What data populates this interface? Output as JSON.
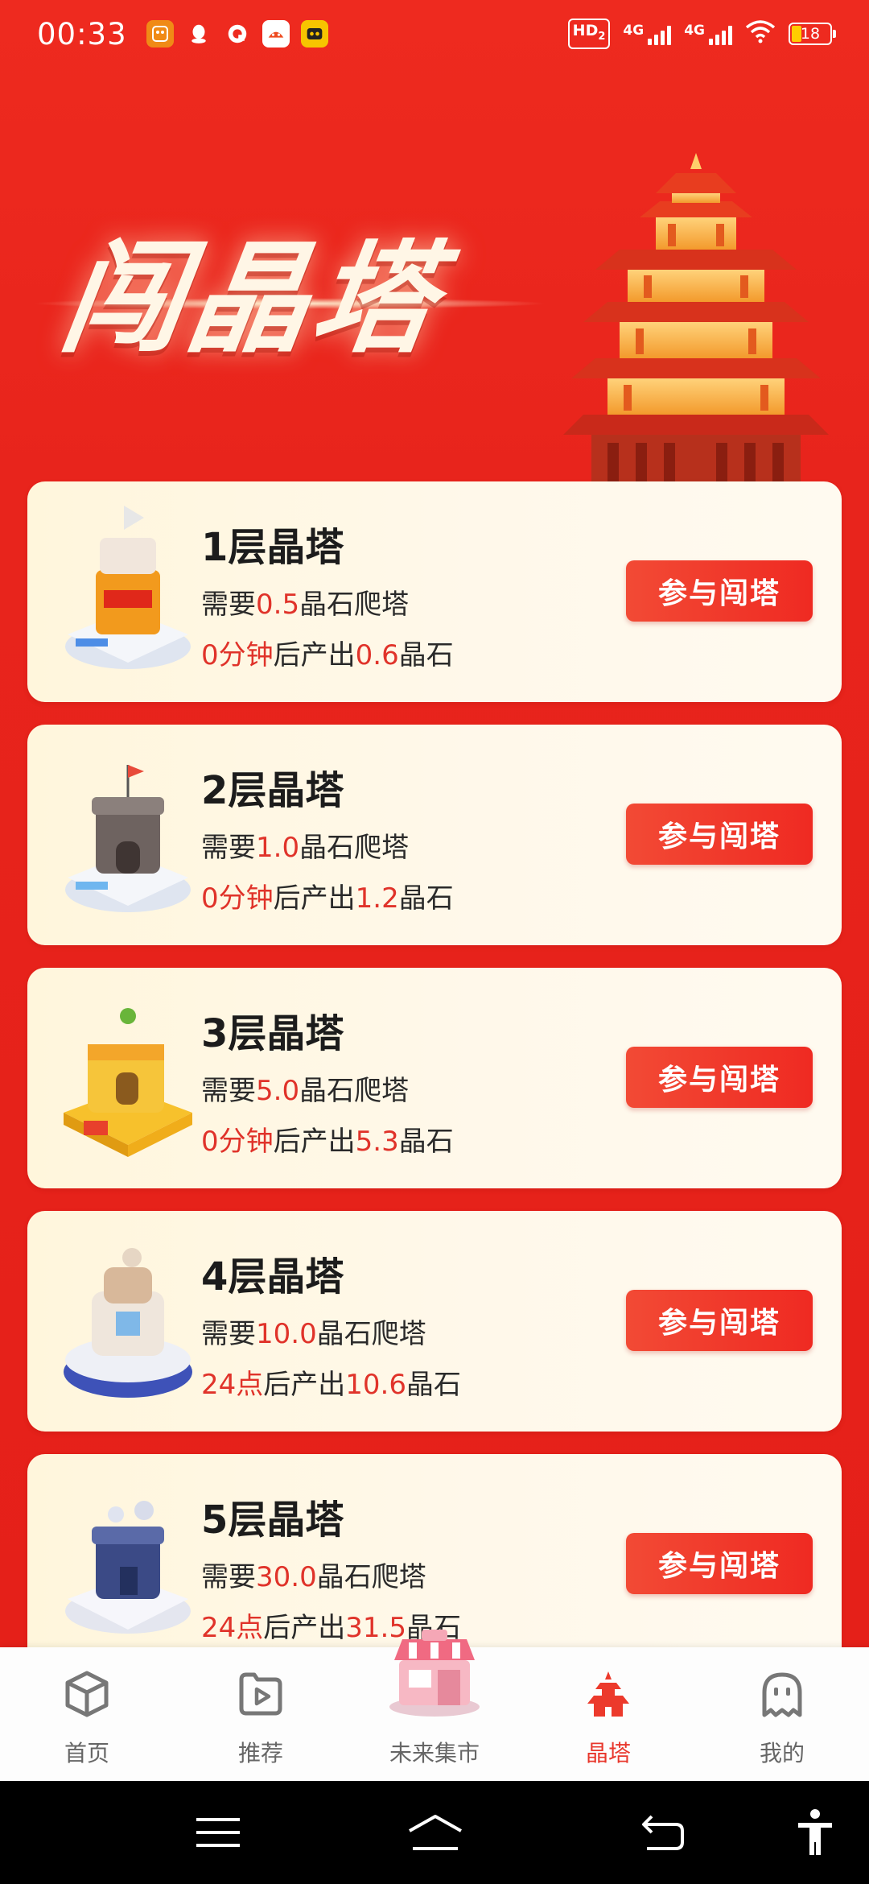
{
  "status_bar": {
    "time": "00:33",
    "app_icons": [
      "baidu-app-icon",
      "qq-icon",
      "quark-icon",
      "taobao-icon",
      "game-icon"
    ],
    "hd_label": "HD",
    "hd_sub": "2",
    "network_1": "4G",
    "network_2": "4G",
    "battery": "18"
  },
  "banner": {
    "title": "闯晶塔"
  },
  "towers": [
    {
      "name": "1层晶塔",
      "need_prefix": "需要",
      "need_value": "0.5",
      "need_suffix": "晶石爬塔",
      "time_value": "0分钟",
      "produce_mid": "后产出",
      "produce_value": "0.6",
      "produce_suffix": "晶石",
      "button": "参与闯塔"
    },
    {
      "name": "2层晶塔",
      "need_prefix": "需要",
      "need_value": "1.0",
      "need_suffix": "晶石爬塔",
      "time_value": "0分钟",
      "produce_mid": "后产出",
      "produce_value": "1.2",
      "produce_suffix": "晶石",
      "button": "参与闯塔"
    },
    {
      "name": "3层晶塔",
      "need_prefix": "需要",
      "need_value": "5.0",
      "need_suffix": "晶石爬塔",
      "time_value": "0分钟",
      "produce_mid": "后产出",
      "produce_value": "5.3",
      "produce_suffix": "晶石",
      "button": "参与闯塔"
    },
    {
      "name": "4层晶塔",
      "need_prefix": "需要",
      "need_value": "10.0",
      "need_suffix": "晶石爬塔",
      "time_value": "24点",
      "produce_mid": "后产出",
      "produce_value": "10.6",
      "produce_suffix": "晶石",
      "button": "参与闯塔"
    },
    {
      "name": "5层晶塔",
      "need_prefix": "需要",
      "need_value": "30.0",
      "need_suffix": "晶石爬塔",
      "time_value": "24点",
      "produce_mid": "后产出",
      "produce_value": "31.5",
      "produce_suffix": "晶石",
      "button": "参与闯塔"
    }
  ],
  "bottom_nav": {
    "items": [
      {
        "label": "首页",
        "icon": "cube-icon"
      },
      {
        "label": "推荐",
        "icon": "play-icon"
      },
      {
        "label": "未来集市",
        "icon": "market-icon"
      },
      {
        "label": "晶塔",
        "icon": "tower-icon"
      },
      {
        "label": "我的",
        "icon": "profile-icon"
      }
    ],
    "active_index": 3
  },
  "colors": {
    "accent": "#e8231d",
    "highlight_text": "#e0332a",
    "card_bg": "#fff6dc"
  }
}
